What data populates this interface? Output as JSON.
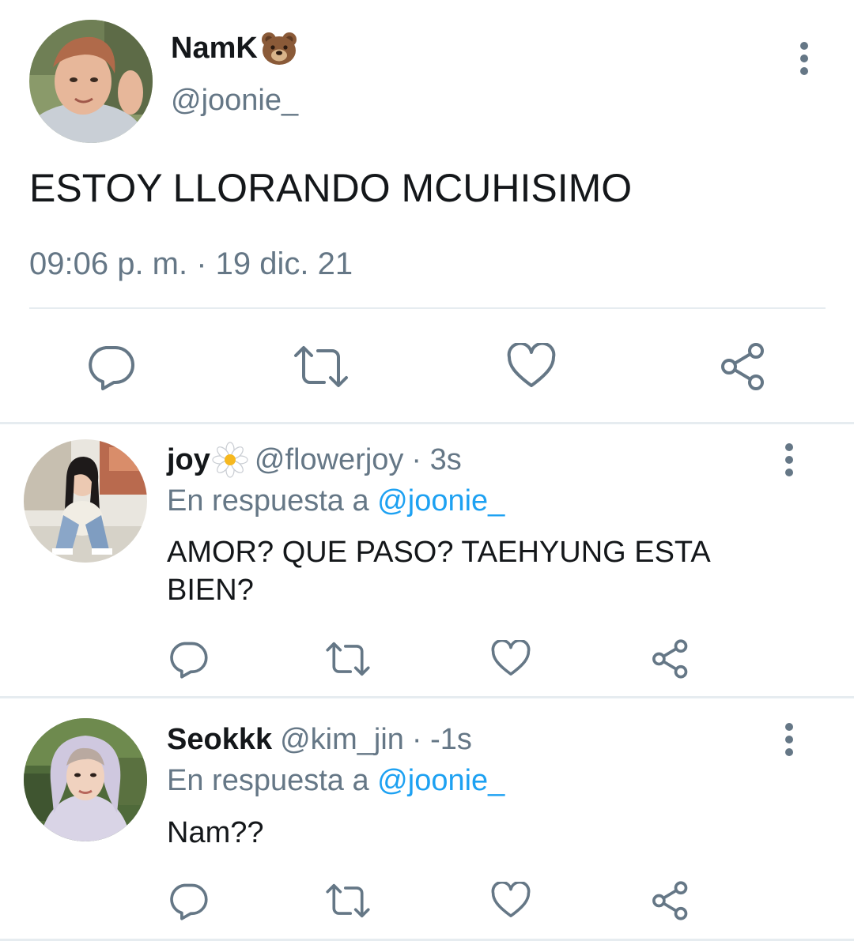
{
  "main_tweet": {
    "display_name": "NamK",
    "name_emoji": "🐻",
    "handle": "@joonie_",
    "text": "ESTOY LLORANDO MCUHISIMO",
    "timestamp": "09:06 p. m. · 19 dic. 21",
    "actions": [
      "reply-icon",
      "retweet-icon",
      "like-icon",
      "share-icon"
    ]
  },
  "replies": [
    {
      "display_name": "joy",
      "name_emoji": "🌼",
      "handle": "@flowerjoy",
      "time": "· 3s",
      "reply_prefix": "En respuesta a",
      "reply_to": "@joonie_",
      "text_line1": "AMOR? QUE PASO? TAEHYUNG ESTA",
      "text_line2": "BIEN?"
    },
    {
      "display_name": "Seokkk",
      "handle": "@kim_jin",
      "time": "· -1s",
      "reply_prefix": "En respuesta a",
      "reply_to": "@joonie_",
      "text_line1": "Nam??"
    }
  ],
  "colors": {
    "text": "#14171a",
    "muted": "#657786",
    "link": "#1da1f2",
    "divider": "#e6ecf0"
  }
}
